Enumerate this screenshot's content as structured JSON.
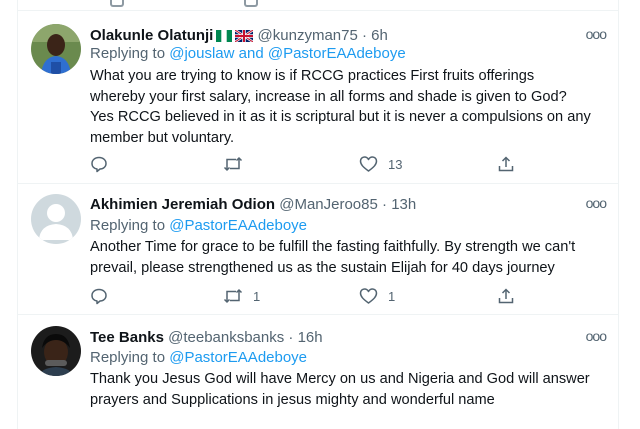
{
  "tweets": [
    {
      "name": "Olakunle Olatunji",
      "handle": "@kunzyman75",
      "time": "6h",
      "replying_prefix": "Replying to ",
      "replying_targets": [
        "@jouslaw",
        "@PastorEAAdeboye"
      ],
      "replying_joiner": " and ",
      "body_lines": [
        "What you are trying to know is if RCCG practices First fruits offerings",
        "whereby your first salary, increase in all forms and shade is given to God?",
        "Yes RCCG believed in it as it is scriptural but it is never a compulsions on any",
        "member but voluntary."
      ],
      "reply_count": "",
      "retweet_count": "",
      "like_count": "13"
    },
    {
      "name": "Akhimien Jeremiah Odion",
      "handle": "@ManJeroo85",
      "time": "13h",
      "replying_prefix": "Replying to ",
      "replying_targets": [
        "@PastorEAAdeboye"
      ],
      "body_lines": [
        "Another Time for grace to be fulfill the fasting faithfully. By strength we can't",
        "prevail,  please strengthened us as the sustain Elijah for 40 days journey"
      ],
      "reply_count": "",
      "retweet_count": "1",
      "like_count": "1"
    },
    {
      "name": "Tee Banks",
      "handle": "@teebanksbanks",
      "time": "16h",
      "replying_prefix": "Replying to ",
      "replying_targets": [
        "@PastorEAAdeboye"
      ],
      "body_lines": [
        "Thank you Jesus God will have Mercy on us and Nigeria and God will answer",
        "prayers and Supplications in jesus mighty and wonderful name"
      ]
    }
  ],
  "separator": "·",
  "more_glyph": "ooo",
  "icons": [
    "reply-icon",
    "retweet-icon",
    "like-icon",
    "share-icon",
    "more-icon",
    "nigeria-flag-icon",
    "uk-flag-icon"
  ],
  "colors": {
    "link": "#1d9bf0",
    "muted": "#536471",
    "text": "#0f1419",
    "border": "#eff3f4"
  }
}
